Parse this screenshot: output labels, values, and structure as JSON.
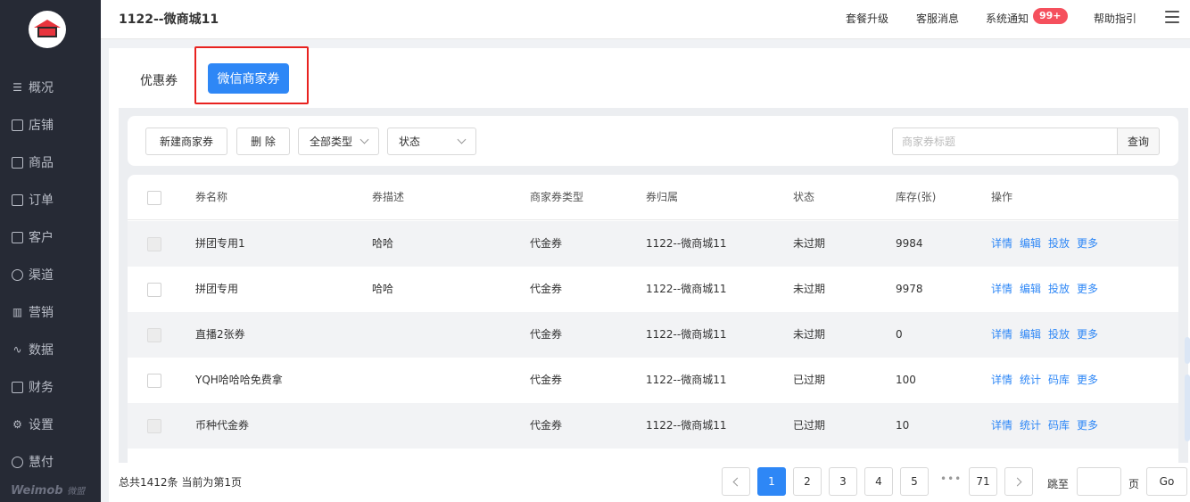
{
  "header": {
    "store_name": "1122--微商城11",
    "links": [
      "套餐升级",
      "客服消息",
      "系统通知",
      "帮助指引"
    ],
    "notification_badge": "99+"
  },
  "sidebar": {
    "items": [
      {
        "label": "概况",
        "icon": "overview-icon"
      },
      {
        "label": "店铺",
        "icon": "store-icon"
      },
      {
        "label": "商品",
        "icon": "goods-icon"
      },
      {
        "label": "订单",
        "icon": "order-icon"
      },
      {
        "label": "客户",
        "icon": "customer-icon"
      },
      {
        "label": "渠道",
        "icon": "channel-icon"
      },
      {
        "label": "营销",
        "icon": "marketing-icon"
      },
      {
        "label": "数据",
        "icon": "data-icon"
      },
      {
        "label": "财务",
        "icon": "finance-icon"
      },
      {
        "label": "设置",
        "icon": "settings-icon"
      },
      {
        "label": "慧付",
        "icon": "pay-icon"
      }
    ],
    "brand": "Weimob",
    "brand_sub": "微盟"
  },
  "tabs": {
    "coupon": "优惠券",
    "merchant_coupon": "微信商家券"
  },
  "toolbar": {
    "new_button": "新建商家券",
    "delete_button": "删 除",
    "type_select": "全部类型",
    "status_select": "状态",
    "search_placeholder": "商家券标题",
    "search_button": "查询"
  },
  "table": {
    "headers": [
      "券名称",
      "券描述",
      "商家券类型",
      "券归属",
      "状态",
      "库存(张)",
      "操作"
    ],
    "rows": [
      {
        "name": "拼团专用1",
        "desc": "哈哈",
        "type": "代金券",
        "owner": "1122--微商城11",
        "status": "未过期",
        "stock": "9984",
        "ops": [
          "详情",
          "编辑",
          "投放",
          "更多"
        ]
      },
      {
        "name": "拼团专用",
        "desc": "哈哈",
        "type": "代金券",
        "owner": "1122--微商城11",
        "status": "未过期",
        "stock": "9978",
        "ops": [
          "详情",
          "编辑",
          "投放",
          "更多"
        ]
      },
      {
        "name": "直播2张券",
        "desc": "",
        "type": "代金券",
        "owner": "1122--微商城11",
        "status": "未过期",
        "stock": "0",
        "ops": [
          "详情",
          "编辑",
          "投放",
          "更多"
        ]
      },
      {
        "name": "YQH哈哈哈免费拿",
        "desc": "",
        "type": "代金券",
        "owner": "1122--微商城11",
        "status": "已过期",
        "stock": "100",
        "ops": [
          "详情",
          "统计",
          "码库",
          "更多"
        ]
      },
      {
        "name": "币种代金券",
        "desc": "",
        "type": "代金券",
        "owner": "1122--微商城11",
        "status": "已过期",
        "stock": "10",
        "ops": [
          "详情",
          "统计",
          "码库",
          "更多"
        ]
      }
    ]
  },
  "pagination": {
    "summary": "总共1412条 当前为第1页",
    "pages": [
      "1",
      "2",
      "3",
      "4",
      "5"
    ],
    "dots": "•••",
    "last_page": "71",
    "current_page": "1",
    "jump_label": "跳至",
    "page_unit": "页",
    "go_button": "Go"
  },
  "colors": {
    "accent": "#2e87f6",
    "sidebar_bg": "#262a35",
    "badge": "#f5505d",
    "highlight_frame": "#e8221f"
  }
}
